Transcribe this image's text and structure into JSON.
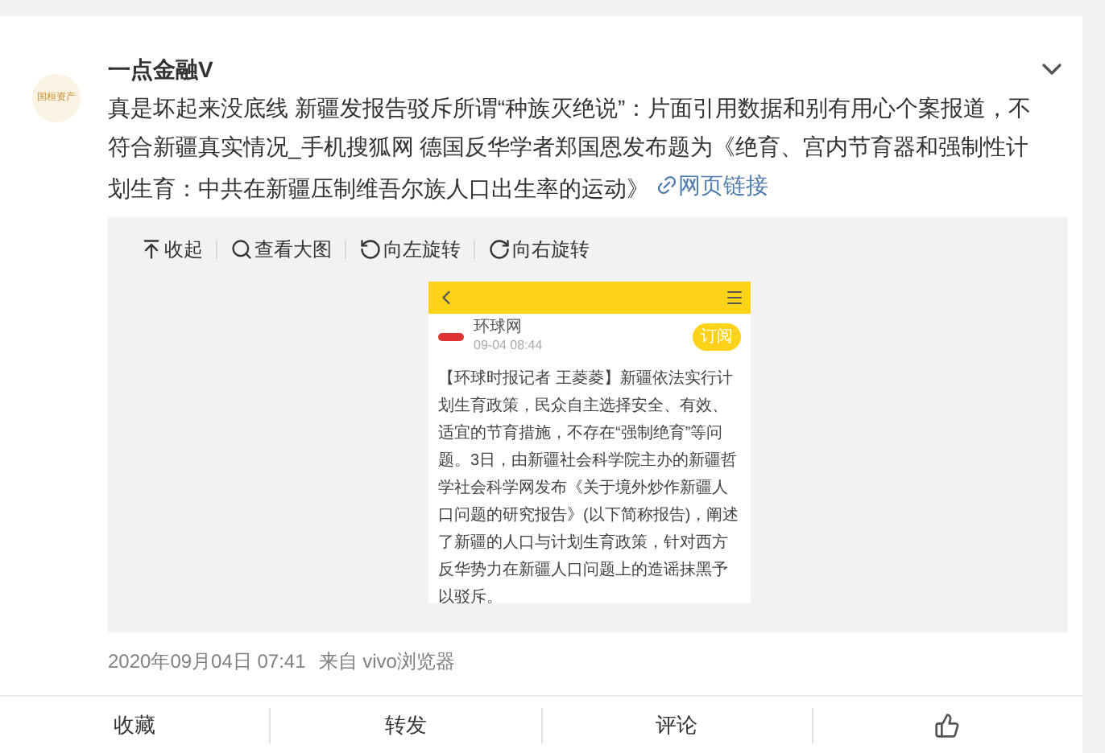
{
  "post": {
    "author": "一点金融V",
    "avatar_text": "国桓资产",
    "text": "真是坏起来没底线 新疆发报告驳斥所谓“种族灭绝说”：片面引用数据和别有用心个案报道，不符合新疆真实情况_手机搜狐网 德国反华学者郑国恩发布题为《绝育、宫内节育器和强制性计划生育：中共在新疆压制维吾尔族人口出生率的运动》",
    "link": "网页链接"
  },
  "image_toolbar": [
    {
      "kind": "collapse",
      "label": "收起"
    },
    {
      "kind": "zoom",
      "label": "查看大图"
    },
    {
      "kind": "rotate_left",
      "label": "向左旋转"
    },
    {
      "kind": "rotate_right",
      "label": "向右旋转"
    }
  ],
  "embedded": {
    "source": "环球网",
    "time": "09-04 08:44",
    "subscribe": "订阅",
    "article": "【环球时报记者 王菱菱】新疆依法实行计划生育政策，民众自主选择安全、有效、适宜的节育措施，不存在“强制绝育”等问题。3日，由新疆社会科学院主办的新疆哲学社会科学网发布《关于境外炒作新疆人口问题的研究报告》(以下简称报告)，阐述了新疆的人口与计划生育政策，针对西方反华势力在新疆人口问题上的造谣抹黑予以驳斥。"
  },
  "meta": {
    "time": "2020年09月04日 07:41",
    "source": "来自 vivo浏览器"
  },
  "actions": [
    {
      "kind": "text",
      "label": "收藏"
    },
    {
      "kind": "text",
      "label": "转发"
    },
    {
      "kind": "text",
      "label": "评论"
    },
    {
      "kind": "like"
    }
  ]
}
